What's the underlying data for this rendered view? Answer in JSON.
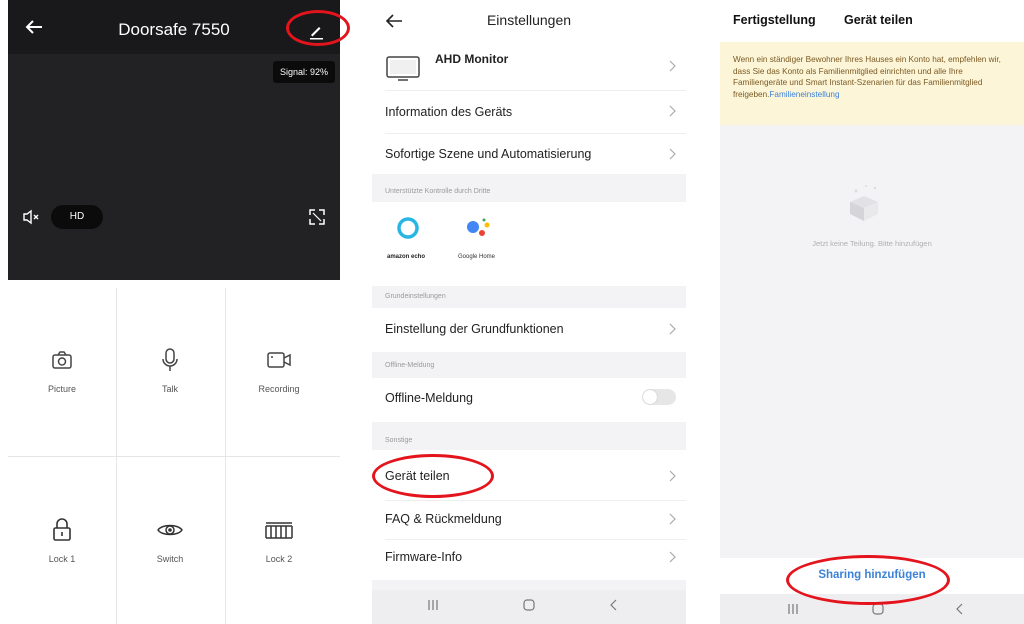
{
  "colors": {
    "annotation": "#e4141c",
    "link": "#3c82d6",
    "notice_bg": "#fdf5d8"
  },
  "camera": {
    "title": "Doorsafe 7550",
    "signal": "Signal: 92%",
    "hd_label": "HD",
    "controls": [
      {
        "label": "Picture",
        "icon": "camera-icon"
      },
      {
        "label": "Talk",
        "icon": "microphone-icon"
      },
      {
        "label": "Recording",
        "icon": "video-camera-icon"
      },
      {
        "label": "Lock 1",
        "icon": "lock-icon"
      },
      {
        "label": "Switch",
        "icon": "eye-icon"
      },
      {
        "label": "Lock 2",
        "icon": "gate-icon"
      }
    ]
  },
  "settings": {
    "title": "Einstellungen",
    "monitor_row": "AHD Monitor",
    "device_info": "Information des Geräts",
    "scene_auto": "Sofortige Szene und Automatisierung",
    "third_party_header": "Unterstützte Kontrolle durch Dritte",
    "alexa_label": "amazon echo",
    "google_label": "Google Home",
    "basic_header": "Grundeinstellungen",
    "basic_functions": "Einstellung der Grundfunktionen",
    "offline_header": "Offline-Meldung",
    "offline_row": "Offline-Meldung",
    "offline_enabled": false,
    "misc_header": "Sonstige",
    "share_device": "Gerät teilen",
    "faq": "FAQ & Rückmeldung",
    "firmware": "Firmware-Info"
  },
  "sharing": {
    "done": "Fertigstellung",
    "title": "Gerät teilen",
    "notice": "Wenn ein ständiger Bewohner Ihres Hauses ein Konto hat, empfehlen wir, dass Sie das Konto als Familienmitglied einrichten und alle Ihre Familiengeräte und Smart Instant-Szenarien für das Familienmitglied freigeben.",
    "notice_link": "Familieneinstellung",
    "empty_text": "Jetzt keine Teilung. Bitte hinzufügen",
    "add_button": "Sharing hinzufügen"
  }
}
